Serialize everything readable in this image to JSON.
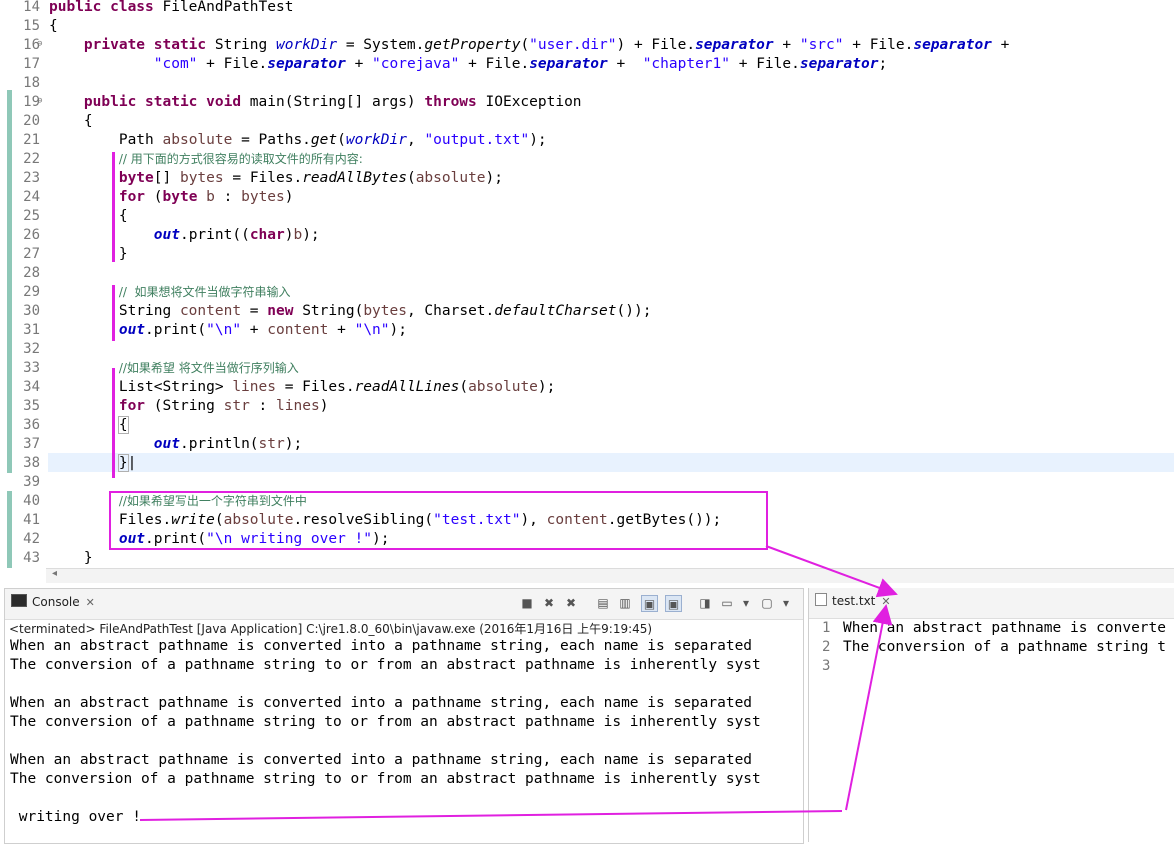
{
  "editor": {
    "line_numbers": [
      "14",
      "15",
      "16",
      "17",
      "18",
      "19",
      "20",
      "21",
      "22",
      "23",
      "24",
      "25",
      "26",
      "27",
      "28",
      "29",
      "30",
      "31",
      "32",
      "33",
      "34",
      "35",
      "36",
      "37",
      "38",
      "39",
      "40",
      "41",
      "42",
      "43"
    ],
    "fold_markers": [
      "⊖",
      "⊖"
    ]
  },
  "console": {
    "tab_label": "Console",
    "toolbar_icons": [
      "terminate-icon",
      "remove-launch-icon",
      "remove-all-icon",
      "clear-console-icon",
      "scroll-lock-icon",
      "show-stdout-icon",
      "show-stderr-icon",
      "pin-console-icon",
      "display-console-icon",
      "open-console-icon"
    ],
    "status": "<terminated> FileAndPathTest [Java Application] C:\\jre1.8.0_60\\bin\\javaw.exe (2016年1月16日 上午9:19:45)",
    "lines": [
      "When an abstract pathname is converted into a pathname string, each name is separated",
      "The conversion of a pathname string to or from an abstract pathname is inherently syst",
      "",
      "When an abstract pathname is converted into a pathname string, each name is separated",
      "The conversion of a pathname string to or from an abstract pathname is inherently syst",
      "",
      "When an abstract pathname is converted into a pathname string, each name is separated",
      "The conversion of a pathname string to or from an abstract pathname is inherently syst",
      "",
      " writing over !"
    ]
  },
  "textfile": {
    "tab_label": "test.txt",
    "line_numbers": [
      "1",
      "2",
      "3"
    ],
    "lines": [
      "When an abstract pathname is converte",
      "The conversion of a pathname string t",
      ""
    ]
  },
  "colors": {
    "annotation": "#e020e0",
    "keyword": "#7f0055",
    "string": "#2a00ff",
    "comment": "#3f7f5f",
    "field": "#0000c0"
  }
}
